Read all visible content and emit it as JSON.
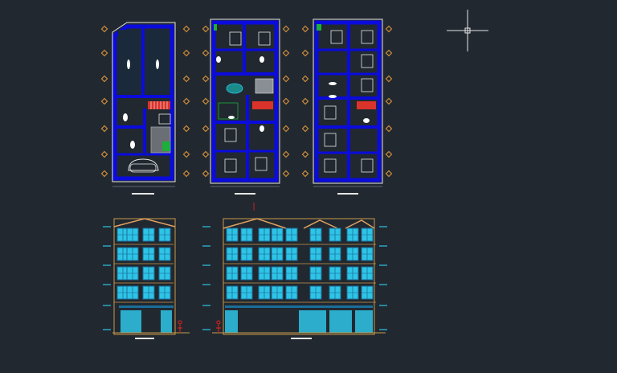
{
  "canvas": {
    "background": "#212830",
    "colors": {
      "wall": "#0a0bdc",
      "wall_dark": "#0a0b9a",
      "outline": "#e6e6e6",
      "column_marker": "#c98a3a",
      "hatch_red": "#d9332b",
      "glass": "#2ec4e6",
      "glass_dark": "#1a6e9a",
      "facade_line": "#c79a4a",
      "roof": "#e0a060",
      "green": "#1fae3a",
      "dim": "#9aa4ae",
      "crosshair": "#e8e8e8",
      "red_mark": "#cc2222"
    }
  },
  "plans": [
    {
      "id": "ground-floor-plan"
    },
    {
      "id": "typical-floor-plan-a"
    },
    {
      "id": "typical-floor-plan-b"
    }
  ],
  "elevations": [
    {
      "id": "side-elevation"
    },
    {
      "id": "front-elevation"
    }
  ],
  "cursor": {
    "type": "crosshair"
  }
}
